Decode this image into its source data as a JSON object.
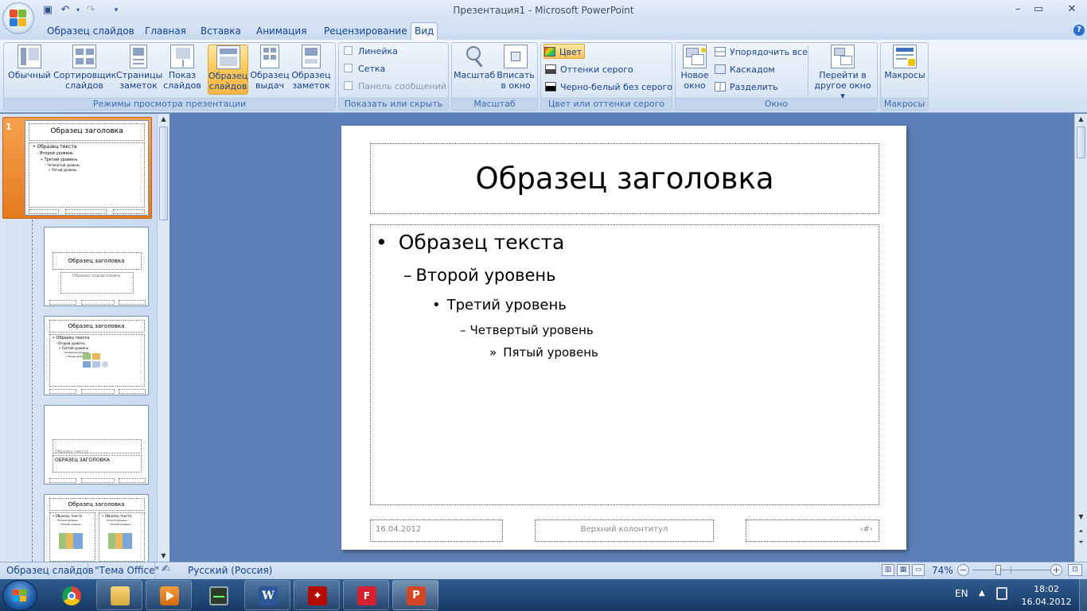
{
  "window": {
    "title": "Презентация1 - Microsoft PowerPoint"
  },
  "tabs": [
    "Образец слайдов",
    "Главная",
    "Вставка",
    "Анимация",
    "Рецензирование",
    "Вид"
  ],
  "ribbon": {
    "views": {
      "label": "Режимы просмотра презентации",
      "buttons": [
        {
          "line1": "Обычный",
          "line2": ""
        },
        {
          "line1": "Сортировщик",
          "line2": "слайдов"
        },
        {
          "line1": "Страницы",
          "line2": "заметок"
        },
        {
          "line1": "Показ",
          "line2": "слайдов"
        },
        {
          "line1": "Образец",
          "line2": "слайдов"
        },
        {
          "line1": "Образец",
          "line2": "выдач"
        },
        {
          "line1": "Образец",
          "line2": "заметок"
        }
      ]
    },
    "show": {
      "label": "Показать или скрыть",
      "items": [
        "Линейка",
        "Сетка",
        "Панель сообщений"
      ]
    },
    "zoom": {
      "label": "Масштаб",
      "buttons": [
        {
          "line1": "Масштаб",
          "line2": ""
        },
        {
          "line1": "Вписать",
          "line2": "в окно"
        }
      ]
    },
    "color": {
      "label": "Цвет или оттенки серого",
      "items": [
        "Цвет",
        "Оттенки серого",
        "Черно-белый без серого"
      ]
    },
    "window": {
      "label": "Окно",
      "new_window": {
        "line1": "Новое",
        "line2": "окно"
      },
      "small": [
        "Упорядочить все",
        "Каскадом",
        "Разделить"
      ],
      "switch": {
        "line1": "Перейти в",
        "line2": "другое окно ▾"
      }
    },
    "macros": {
      "label": "Макросы",
      "button": "Макросы"
    }
  },
  "thumbnails": {
    "t1": {
      "num": "1",
      "title": "Образец заголовка",
      "lines": [
        "• Образец текста",
        "– Второй уровень",
        "• Третий уровень",
        "– Четвертый уровень",
        "» Пятый уровень"
      ]
    },
    "t2": {
      "title": "Образец заголовка",
      "sub": "Образец подзаголовка"
    },
    "t3": {
      "title": "Образец заголовка",
      "lines": [
        "• Образец текста",
        "– Второй уровень",
        "• Третий уровень",
        "– Четвертый уровень",
        "» Пятый уровень"
      ]
    },
    "t4": {
      "text": "Образец текста",
      "title": "ОБРАЗЕЦ ЗАГОЛОВКА"
    },
    "t5": {
      "title": "Образец заголовка",
      "lines": [
        "• Образец текста",
        "– Второй уровень",
        "• Третий уровень",
        "– Четвертый уровень",
        "» Пятый уровень"
      ]
    }
  },
  "slide": {
    "title": "Образец заголовка",
    "levels": [
      "Образец текста",
      "Второй уровень",
      "Третий уровень",
      "Четвертый уровень",
      "Пятый уровень"
    ],
    "bullets": [
      "•",
      "–",
      "•",
      "–",
      "»"
    ],
    "footer": {
      "date": "16.04.2012",
      "header": "Верхний колонтитул",
      "number": "‹#›"
    }
  },
  "status": {
    "mode": "Образец слайдов",
    "theme": "\"Тема Office\"",
    "language": "Русский (Россия)",
    "zoom": "74%"
  },
  "taskbar": {
    "lang": "EN",
    "time": "18:02",
    "date": "16.04.2012"
  }
}
